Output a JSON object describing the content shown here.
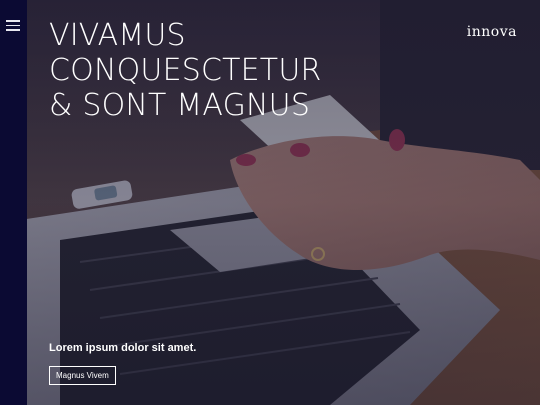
{
  "nav": {
    "menu_icon": "hamburger-icon"
  },
  "header": {
    "brand": "innova",
    "headline": [
      "VIVAMUS",
      "CONQUESCTETUR",
      "& SONT MAGNUS"
    ]
  },
  "hero": {
    "subtitle": "Lorem ipsum dolor sit amet.",
    "cta_label": "Magnus Vivem"
  },
  "colors": {
    "sidebar": "#0b0a33",
    "text": "#ffffff"
  }
}
